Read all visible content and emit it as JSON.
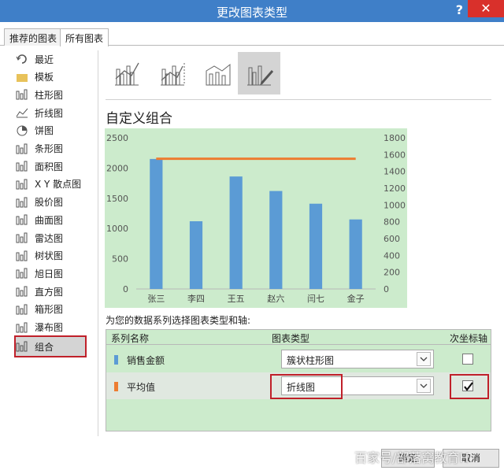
{
  "window": {
    "title": "更改图表类型",
    "help": "?",
    "close": "✕"
  },
  "tabs": [
    {
      "label": "推荐的图表"
    },
    {
      "label": "所有图表"
    }
  ],
  "sidebar": {
    "items": [
      {
        "label": "最近",
        "icon": "recent-icon"
      },
      {
        "label": "模板",
        "icon": "folder-icon"
      },
      {
        "label": "柱形图",
        "icon": "column-chart-icon"
      },
      {
        "label": "折线图",
        "icon": "line-chart-icon"
      },
      {
        "label": "饼图",
        "icon": "pie-chart-icon"
      },
      {
        "label": "条形图",
        "icon": "bar-chart-icon"
      },
      {
        "label": "面积图",
        "icon": "area-chart-icon"
      },
      {
        "label": "X Y 散点图",
        "icon": "scatter-chart-icon"
      },
      {
        "label": "股价图",
        "icon": "stock-chart-icon"
      },
      {
        "label": "曲面图",
        "icon": "surface-chart-icon"
      },
      {
        "label": "雷达图",
        "icon": "radar-chart-icon"
      },
      {
        "label": "树状图",
        "icon": "treemap-icon"
      },
      {
        "label": "旭日图",
        "icon": "sunburst-icon"
      },
      {
        "label": "直方图",
        "icon": "histogram-icon"
      },
      {
        "label": "箱形图",
        "icon": "box-whisker-icon"
      },
      {
        "label": "瀑布图",
        "icon": "waterfall-icon"
      },
      {
        "label": "组合",
        "icon": "combo-chart-icon"
      }
    ],
    "selected": 16
  },
  "combo_types": {
    "selected": 3
  },
  "main": {
    "section_title": "自定义组合",
    "prompt": "为您的数据系列选择图表类型和轴:",
    "col_series": "系列名称",
    "col_type": "图表类型",
    "col_secondary": "次坐标轴",
    "series_rows": [
      {
        "name": "销售金额",
        "type": "簇状柱形图",
        "secondary": false,
        "color": "#5b9bd5"
      },
      {
        "name": "平均值",
        "type": "折线图",
        "secondary": true,
        "color": "#ed7d31"
      }
    ]
  },
  "buttons": {
    "ok": "确定",
    "cancel": "取消"
  },
  "watermark": "百家号/部落窝教育H",
  "colors": {
    "titlebar": "#3f7fc8",
    "highlight": "#c0202a",
    "panel": "#ccebcc",
    "bar": "#5b9bd5",
    "line": "#ed7d31"
  },
  "chart_data": {
    "type": "bar",
    "categories": [
      "张三",
      "李四",
      "王五",
      "赵六",
      "闫七",
      "金子"
    ],
    "series": [
      {
        "kind": "bar",
        "axis": "primary",
        "values": [
          2150,
          1120,
          1860,
          1620,
          1410,
          1150
        ]
      },
      {
        "kind": "line",
        "axis": "secondary",
        "values": [
          1550,
          1550,
          1550,
          1550,
          1550,
          1550
        ]
      }
    ],
    "ylim": [
      0,
      2500
    ],
    "y_ticks": [
      "0",
      "500",
      "1000",
      "1500",
      "2000",
      "2500"
    ],
    "y2lim": [
      0,
      1800
    ],
    "y2_ticks": [
      "0",
      "200",
      "400",
      "600",
      "800",
      "1000",
      "1200",
      "1400",
      "1600",
      "1800"
    ],
    "grid": false,
    "legend": "none"
  }
}
